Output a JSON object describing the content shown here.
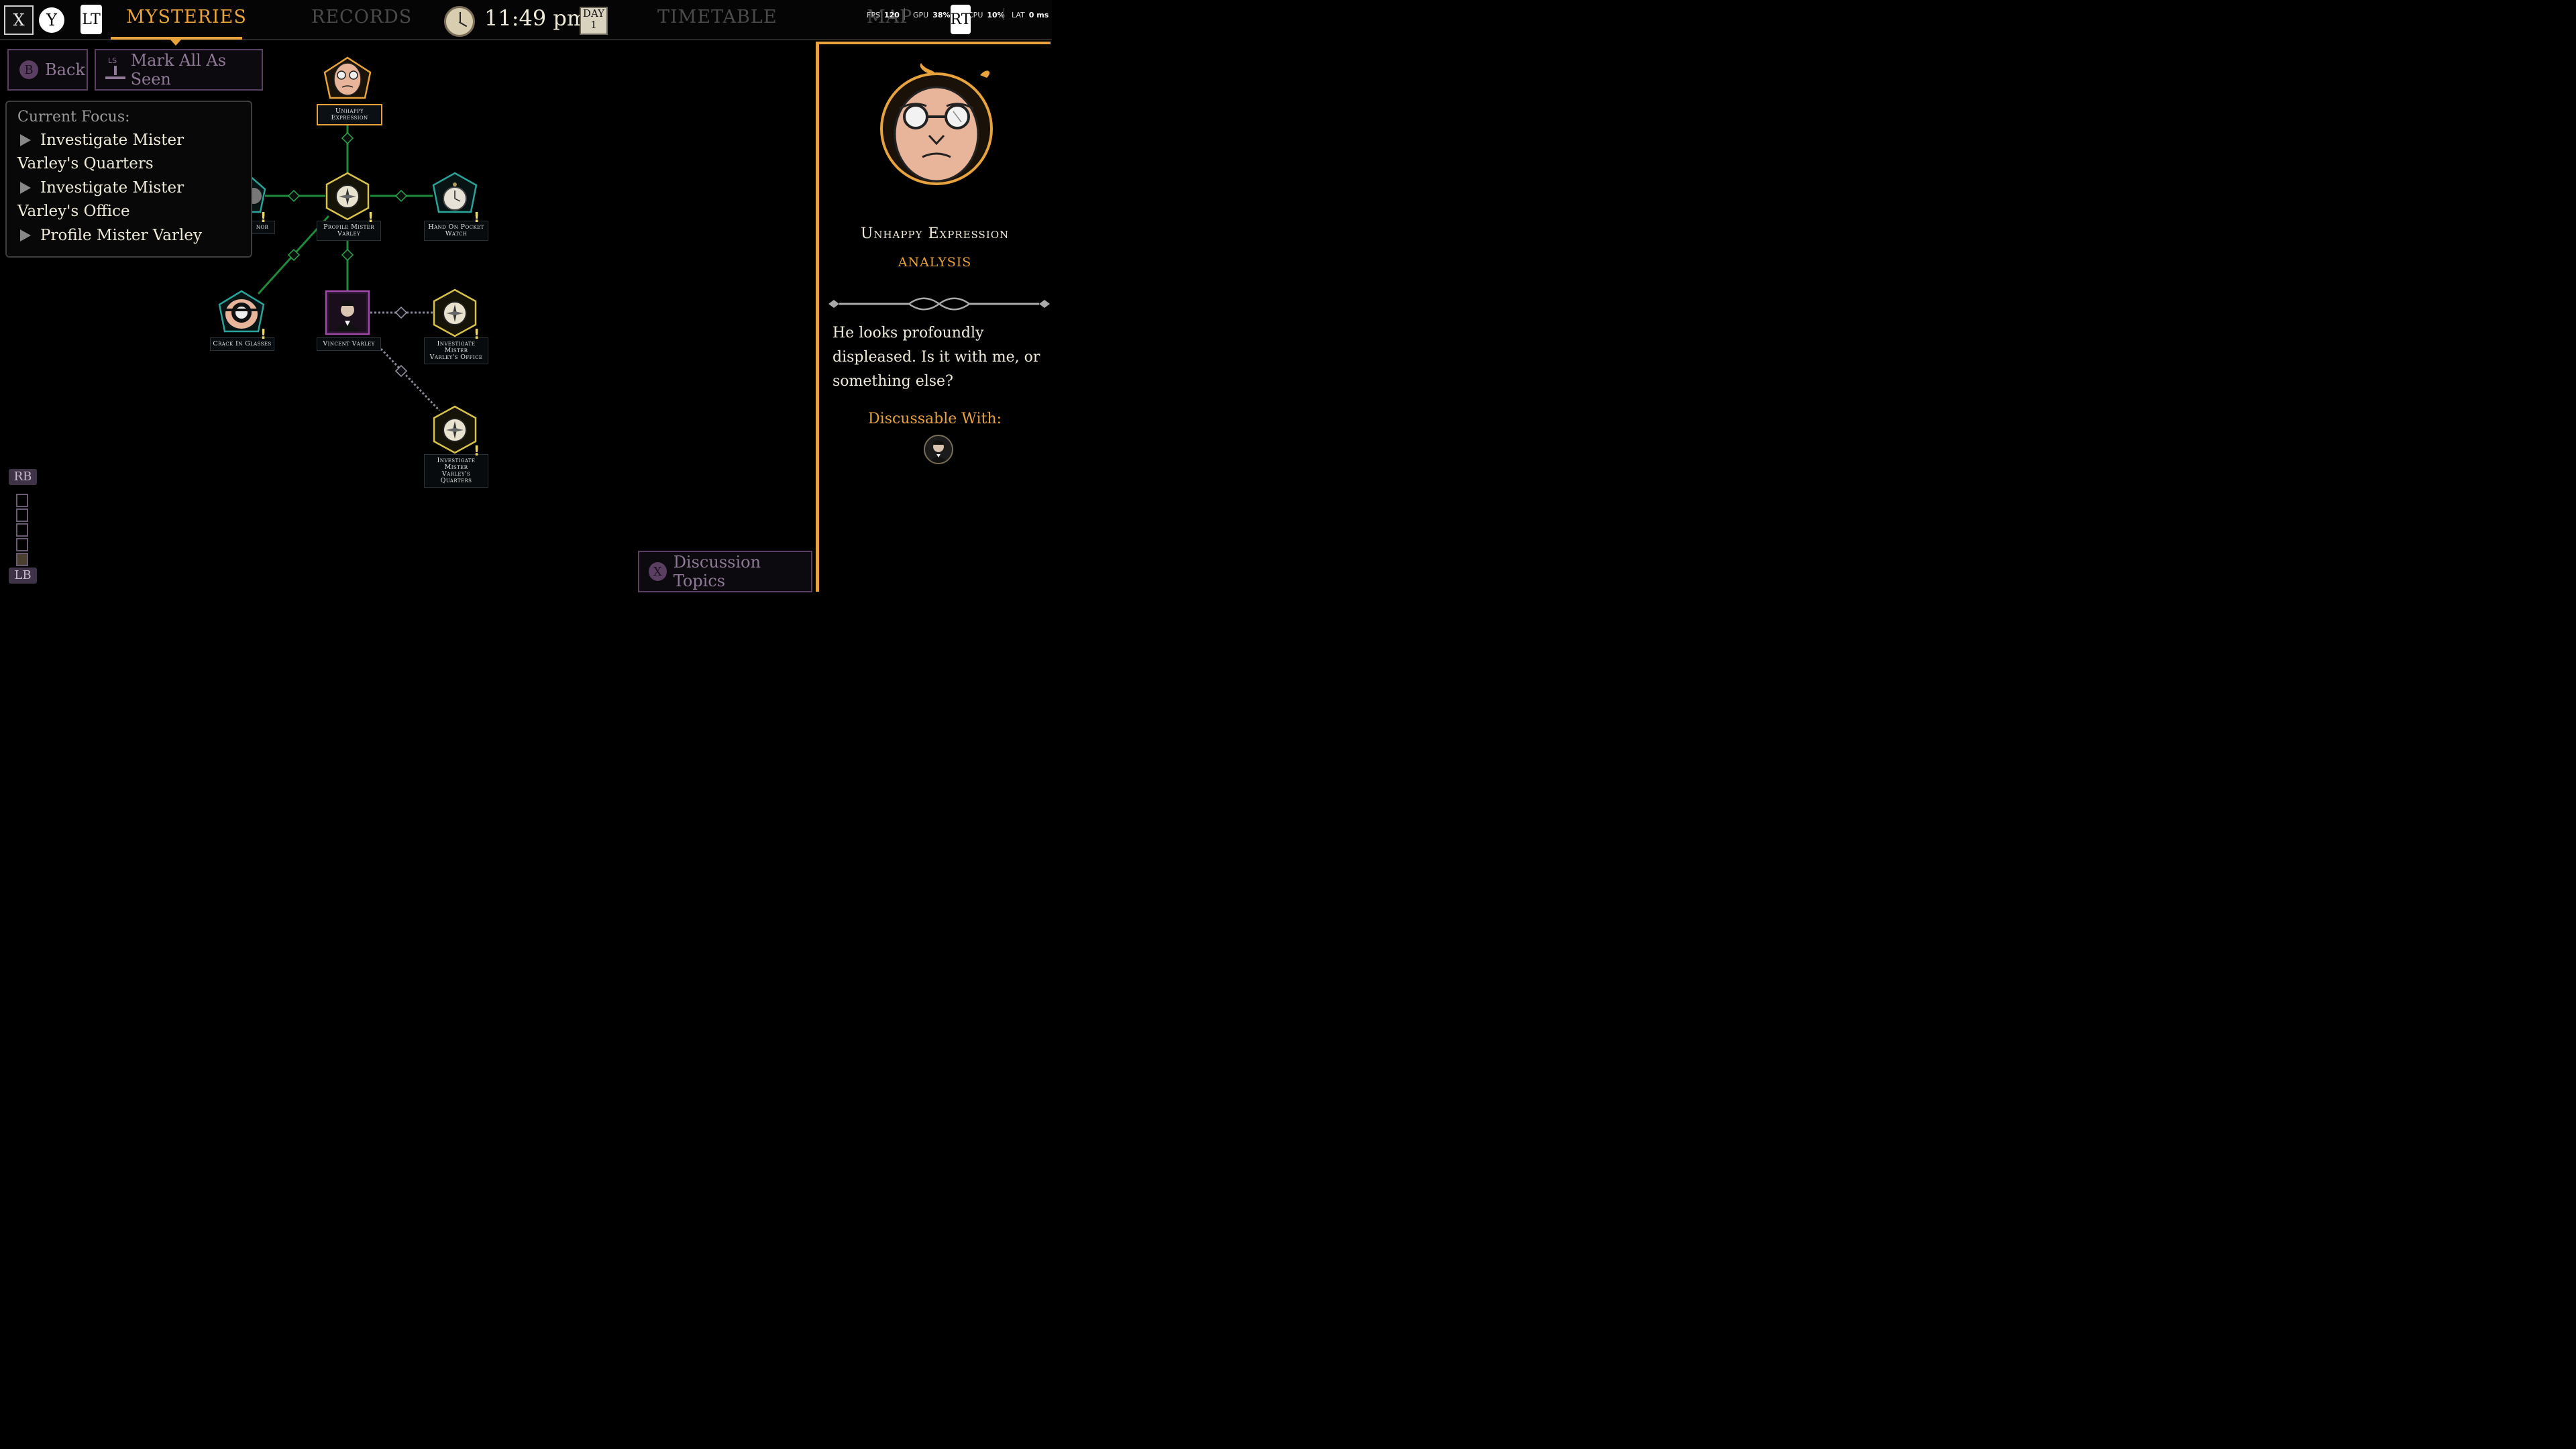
{
  "top_bar": {
    "key_x": "X",
    "key_y": "Y",
    "key_lt": "LT",
    "key_rt": "RT",
    "tabs": [
      {
        "label": "MYSTERIES",
        "active": true
      },
      {
        "label": "RECORDS",
        "active": false
      },
      {
        "label": "TIMETABLE",
        "active": false
      },
      {
        "label": "MAP",
        "active": false
      }
    ],
    "time": "11:49 pm",
    "day_label": "DAY",
    "day_number": "1",
    "accent_color": "#e8a33d"
  },
  "perf_overlay": {
    "fps_label": "FPS",
    "fps_value": "120",
    "gpu_label": "GPU",
    "gpu_value": "38%",
    "cpu_label": "CPU",
    "cpu_value": "10%",
    "lat_label": "LAT",
    "lat_value": "0 ms"
  },
  "actions": {
    "back_key": "B",
    "back_label": "Back",
    "mark_key": "LS",
    "mark_label": "Mark All As Seen",
    "discussion_key": "X",
    "discussion_label": "Discussion Topics"
  },
  "focus_panel": {
    "title": "Current Focus:",
    "items": [
      "Investigate Mister Varley's Quarters",
      "Investigate Mister Varley's Office",
      "Profile Mister Varley"
    ]
  },
  "graph": {
    "nodes": [
      {
        "id": "unhappy",
        "label_1": "Unhappy",
        "label_2": "Expression",
        "selected": true,
        "icon": "bald-man-portrait-icon"
      },
      {
        "id": "profile",
        "label_1": "Profile Mister",
        "label_2": "Varley",
        "alert": "!",
        "icon": "compass-icon"
      },
      {
        "id": "hand",
        "label_1": "Hand On Pocket",
        "label_2": "Watch",
        "alert": "!",
        "icon": "pocket-watch-icon"
      },
      {
        "id": "partial",
        "label_1": "nor",
        "alert": "!",
        "icon": "partial-clue-icon"
      },
      {
        "id": "crack",
        "label_1": "Crack In Glasses",
        "alert": "!",
        "icon": "cracked-monocle-icon"
      },
      {
        "id": "vincent",
        "label_1": "Vincent Varley",
        "icon": "vincent-varley-portrait-icon"
      },
      {
        "id": "office",
        "label_1": "Investigate Mister",
        "label_2": "Varley's Office",
        "alert": "!",
        "icon": "compass-icon"
      },
      {
        "id": "quarters",
        "label_1": "Investigate Mister",
        "label_2": "Varley's Quarters",
        "alert": "!",
        "icon": "compass-icon"
      }
    ],
    "link_color": "#1f8a3a",
    "dashed_link_color": "#8a8a9a"
  },
  "zoom": {
    "rb": "RB",
    "lb": "LB"
  },
  "detail": {
    "title": "Unhappy Expression",
    "type": "ANALYSIS",
    "description": "He looks profoundly displeased. Is it with me, or something else?",
    "discussable_label": "Discussable With:",
    "discussable_icon": "vincent-varley-avatar-icon"
  }
}
